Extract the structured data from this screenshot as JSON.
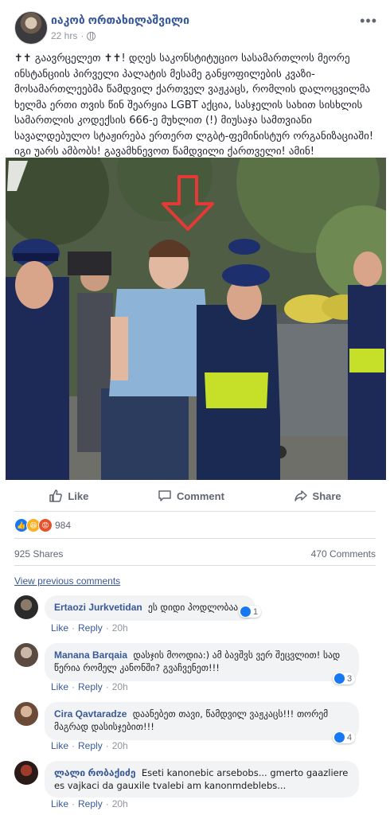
{
  "post": {
    "author": "იაკობ ორთახილაშვილი",
    "time": "22 hrs",
    "privacy_icon": "globe-icon",
    "text": "✝✝ გაავრცელეთ ✝✝! დღეს საკონსტიტუციო სასამართლოს მეორე ინსტანციის პირველი პალატის მესამე განყოფილების კვაზი-მოსამართლეებმა წამდვილ ქართველ ვაჟკაცს, რომლის დალოცვილმა ხელმა ერთი თვის წინ შეარყია LGBT აქცია, სასჯელის სახით სისხლის სამართლის კოდექსის 666-ე მუხლით (!) მიუსაჯა სამთვიანი სავალდებულო სტაჟირება ერთერთ ლგბტ-ფემინისტურ ორგანიზაციაში! იგი უარს ამბობს! გავამხნევოთ წამდვილი ქართველი! ამინ!"
  },
  "actions": {
    "like": "Like",
    "comment": "Comment",
    "share": "Share"
  },
  "reactions": {
    "count": "984",
    "types": [
      "like",
      "haha",
      "angry"
    ]
  },
  "stats": {
    "shares": "925 Shares",
    "comments": "470 Comments"
  },
  "view_previous": "View previous comments",
  "comments": [
    {
      "name": "Ertaozi Jurkvetidan",
      "text": "ეს დიდი პოდლობაა",
      "likes": "1",
      "time": "20h",
      "like": "Like",
      "reply": "Reply"
    },
    {
      "name": "Manana Barqaia",
      "text": "დასჯის მოოდია:) ამ ბავშვს ვერ შეცვლით! სად წერია რომელ კანონში? გვაჩვენეთ!!!",
      "likes": "3",
      "time": "20h",
      "like": "Like",
      "reply": "Reply"
    },
    {
      "name": "Cira Qavtaradze",
      "text": "დაანებეთ თავი, წამდვილ ვაჟკაცს!!! თორემ მაგრად დასისჯებით!!!",
      "likes": "4",
      "time": "20h",
      "like": "Like",
      "reply": "Reply"
    },
    {
      "name": "ლალი რობაქიძე",
      "text": "Eseti kanonebic arsebobs... gmerto gaazliere es vajkaci da gauxile tvalebi am kanonmdeblebs...",
      "likes": "",
      "time": "20h",
      "like": "Like",
      "reply": "Reply"
    }
  ],
  "colors": {
    "link": "#385898",
    "muted": "#606770",
    "like_blue": "#1877f2",
    "arrow_red": "#e53935"
  }
}
